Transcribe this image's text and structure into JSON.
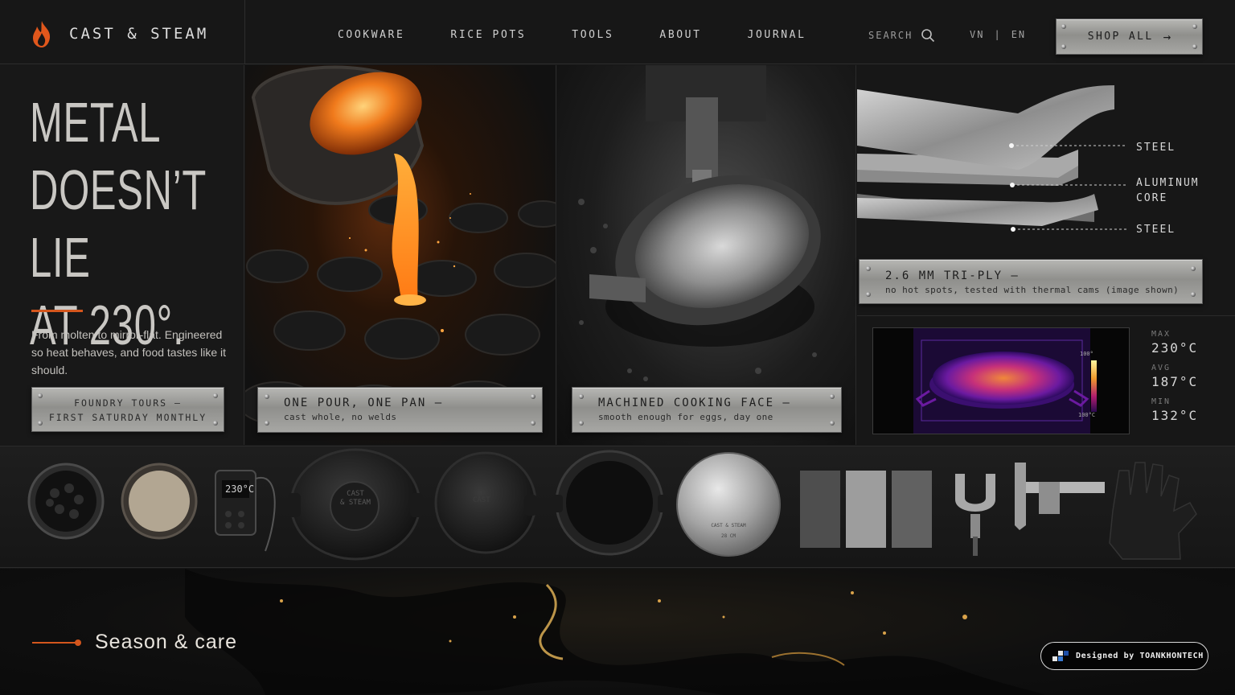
{
  "header": {
    "brand": "CAST & STEAM",
    "nav": [
      "COOKWARE",
      "RICE POTS",
      "TOOLS",
      "ABOUT",
      "JOURNAL"
    ],
    "search_label": "SEARCH",
    "lang": {
      "vn": "VN",
      "sep": "|",
      "en": "EN"
    },
    "shop_label": "SHOP ALL",
    "shop_arrow": "→"
  },
  "hero": {
    "headline_lines": [
      "METAL",
      "DOESN’T LIE",
      "AT 230°."
    ],
    "lede": "From molten to mirror-flat. Engineered so heat behaves, and food tastes like it should.",
    "tours_line1": "FOUNDRY TOURS —",
    "tours_line2": "FIRST SATURDAY MONTHLY"
  },
  "panels": {
    "pour": {
      "title": "ONE POUR, ONE PAN —",
      "sub": "cast whole, no welds"
    },
    "machined": {
      "title": "MACHINED COOKING FACE —",
      "sub": "smooth enough for eggs, day one"
    },
    "triply": {
      "layers": [
        "STEEL",
        "ALUMINUM CORE",
        "STEEL"
      ],
      "layer_mid_lines": [
        "ALUMINUM",
        "CORE"
      ],
      "title": "2.6 MM TRI-PLY —",
      "sub": "no hot spots, tested with thermal cams (image shown)"
    }
  },
  "thermal": {
    "scale_top": "100°",
    "scale_bottom": "100°C",
    "stats": [
      {
        "label": "MAX",
        "value": "230°C"
      },
      {
        "label": "AVG",
        "value": "187°C"
      },
      {
        "label": "MIN",
        "value": "132°C"
      }
    ]
  },
  "products": {
    "thermometer_reading": "230°C",
    "dutch_oven_lid": [
      "CAST",
      "& STEAM"
    ],
    "griddle_mark": "CAST",
    "lid_mark": [
      "CAST & STEAM",
      "28 CM"
    ],
    "items": [
      "coal-bowl",
      "flour-bowl",
      "probe-thermometer",
      "dutch-oven",
      "griddle",
      "skillet",
      "steel-lid",
      "metal-samples",
      "clamp",
      "caliper",
      "gloves"
    ]
  },
  "footer": {
    "season_label": "Season & care",
    "credit": "Designed by TOANKHONTECH"
  },
  "colors": {
    "accent": "#d4561d",
    "plate": "#a6a6a3",
    "background": "#161616"
  }
}
